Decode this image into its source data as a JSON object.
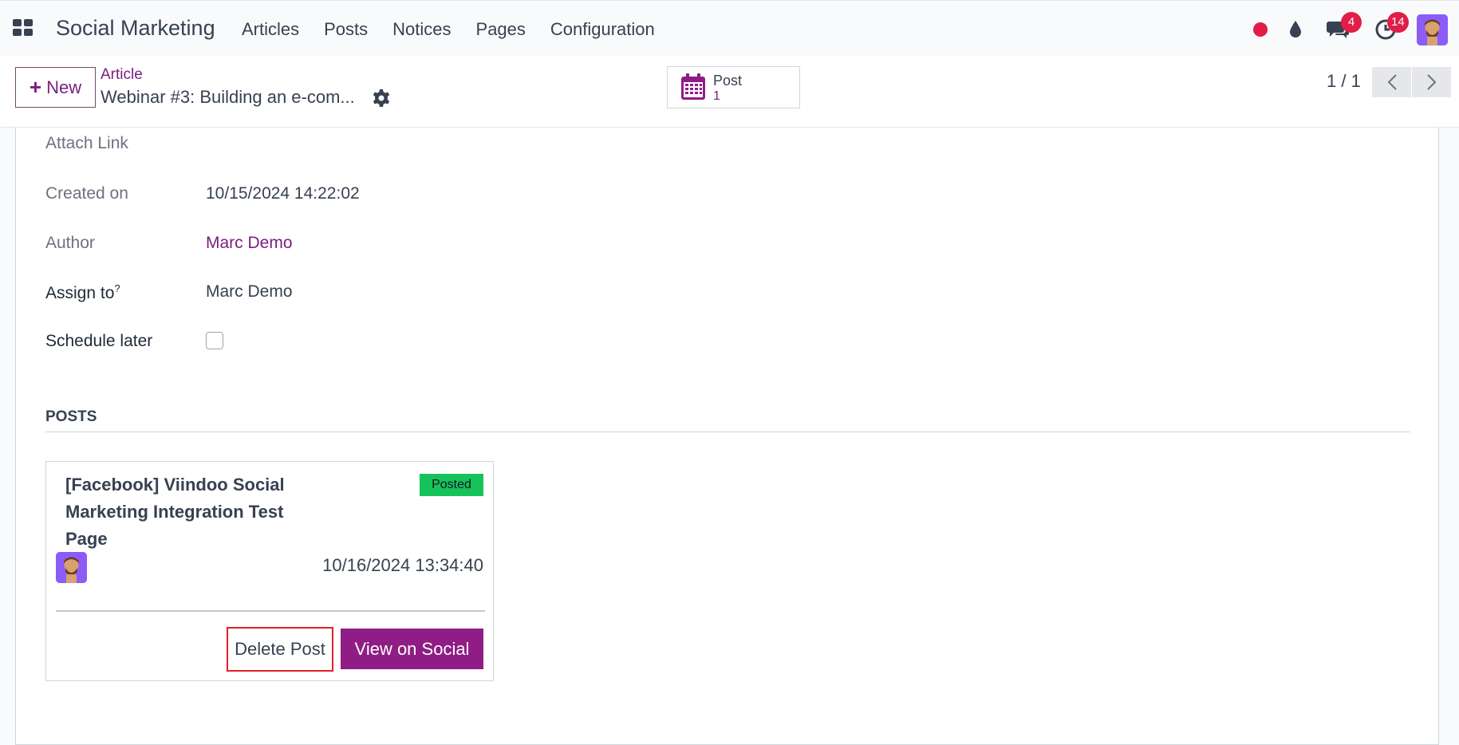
{
  "topnav": {
    "brand": "Social Marketing",
    "menu": [
      "Articles",
      "Posts",
      "Notices",
      "Pages",
      "Configuration"
    ],
    "systray": {
      "messages_count": "4",
      "activities_count": "14"
    }
  },
  "control": {
    "new_label": "New",
    "breadcrumb_parent": "Article",
    "breadcrumb_current": "Webinar #3: Building an e-com...",
    "smart_button": {
      "label": "Post",
      "value": "1"
    },
    "pager": "1 / 1"
  },
  "form": {
    "attach_link_label": "Attach Link",
    "created_on_label": "Created on",
    "created_on_value": "10/15/2024 14:22:02",
    "author_label": "Author",
    "author_value": "Marc Demo",
    "assign_to_label": "Assign to",
    "assign_to_help": "?",
    "assign_to_value": "Marc Demo",
    "schedule_later_label": "Schedule later",
    "posts_section": "POSTS"
  },
  "post": {
    "title": "[Facebook] Viindoo Social Marketing Integration Test Page",
    "status": "Posted",
    "date": "10/16/2024 13:34:40",
    "delete_label": "Delete Post",
    "view_label": "View on Social"
  },
  "colors": {
    "primary": "#8f1d85",
    "link": "#7b1d7f",
    "badge": "#e11d48",
    "posted": "#16c35a",
    "highlight": "#e11d28"
  }
}
